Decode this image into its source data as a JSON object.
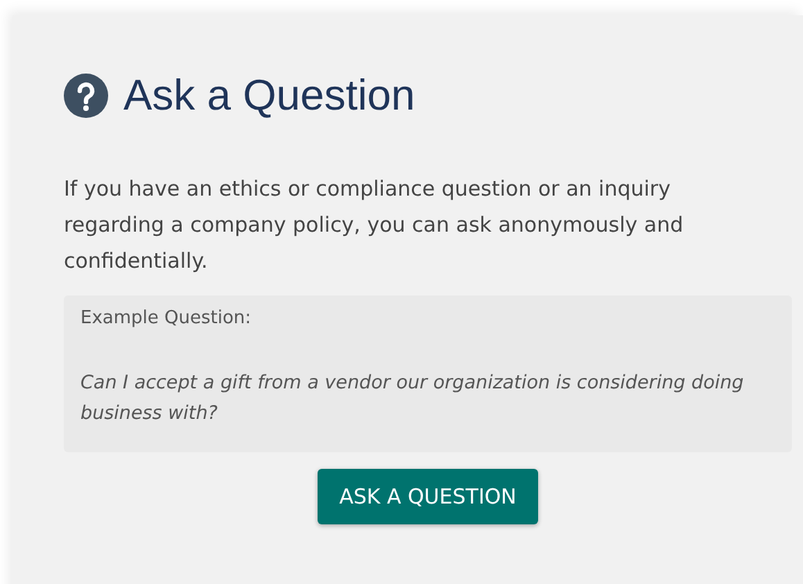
{
  "title": "Ask a Question",
  "intro": "If you have an ethics or compliance question or an inquiry regarding a company policy, you can ask anonymously and confidentially.",
  "example": {
    "label": "Example Question:",
    "question": "Can I accept a gift from a vendor our organization is considering doing business with?"
  },
  "button": "ASK A QUESTION"
}
